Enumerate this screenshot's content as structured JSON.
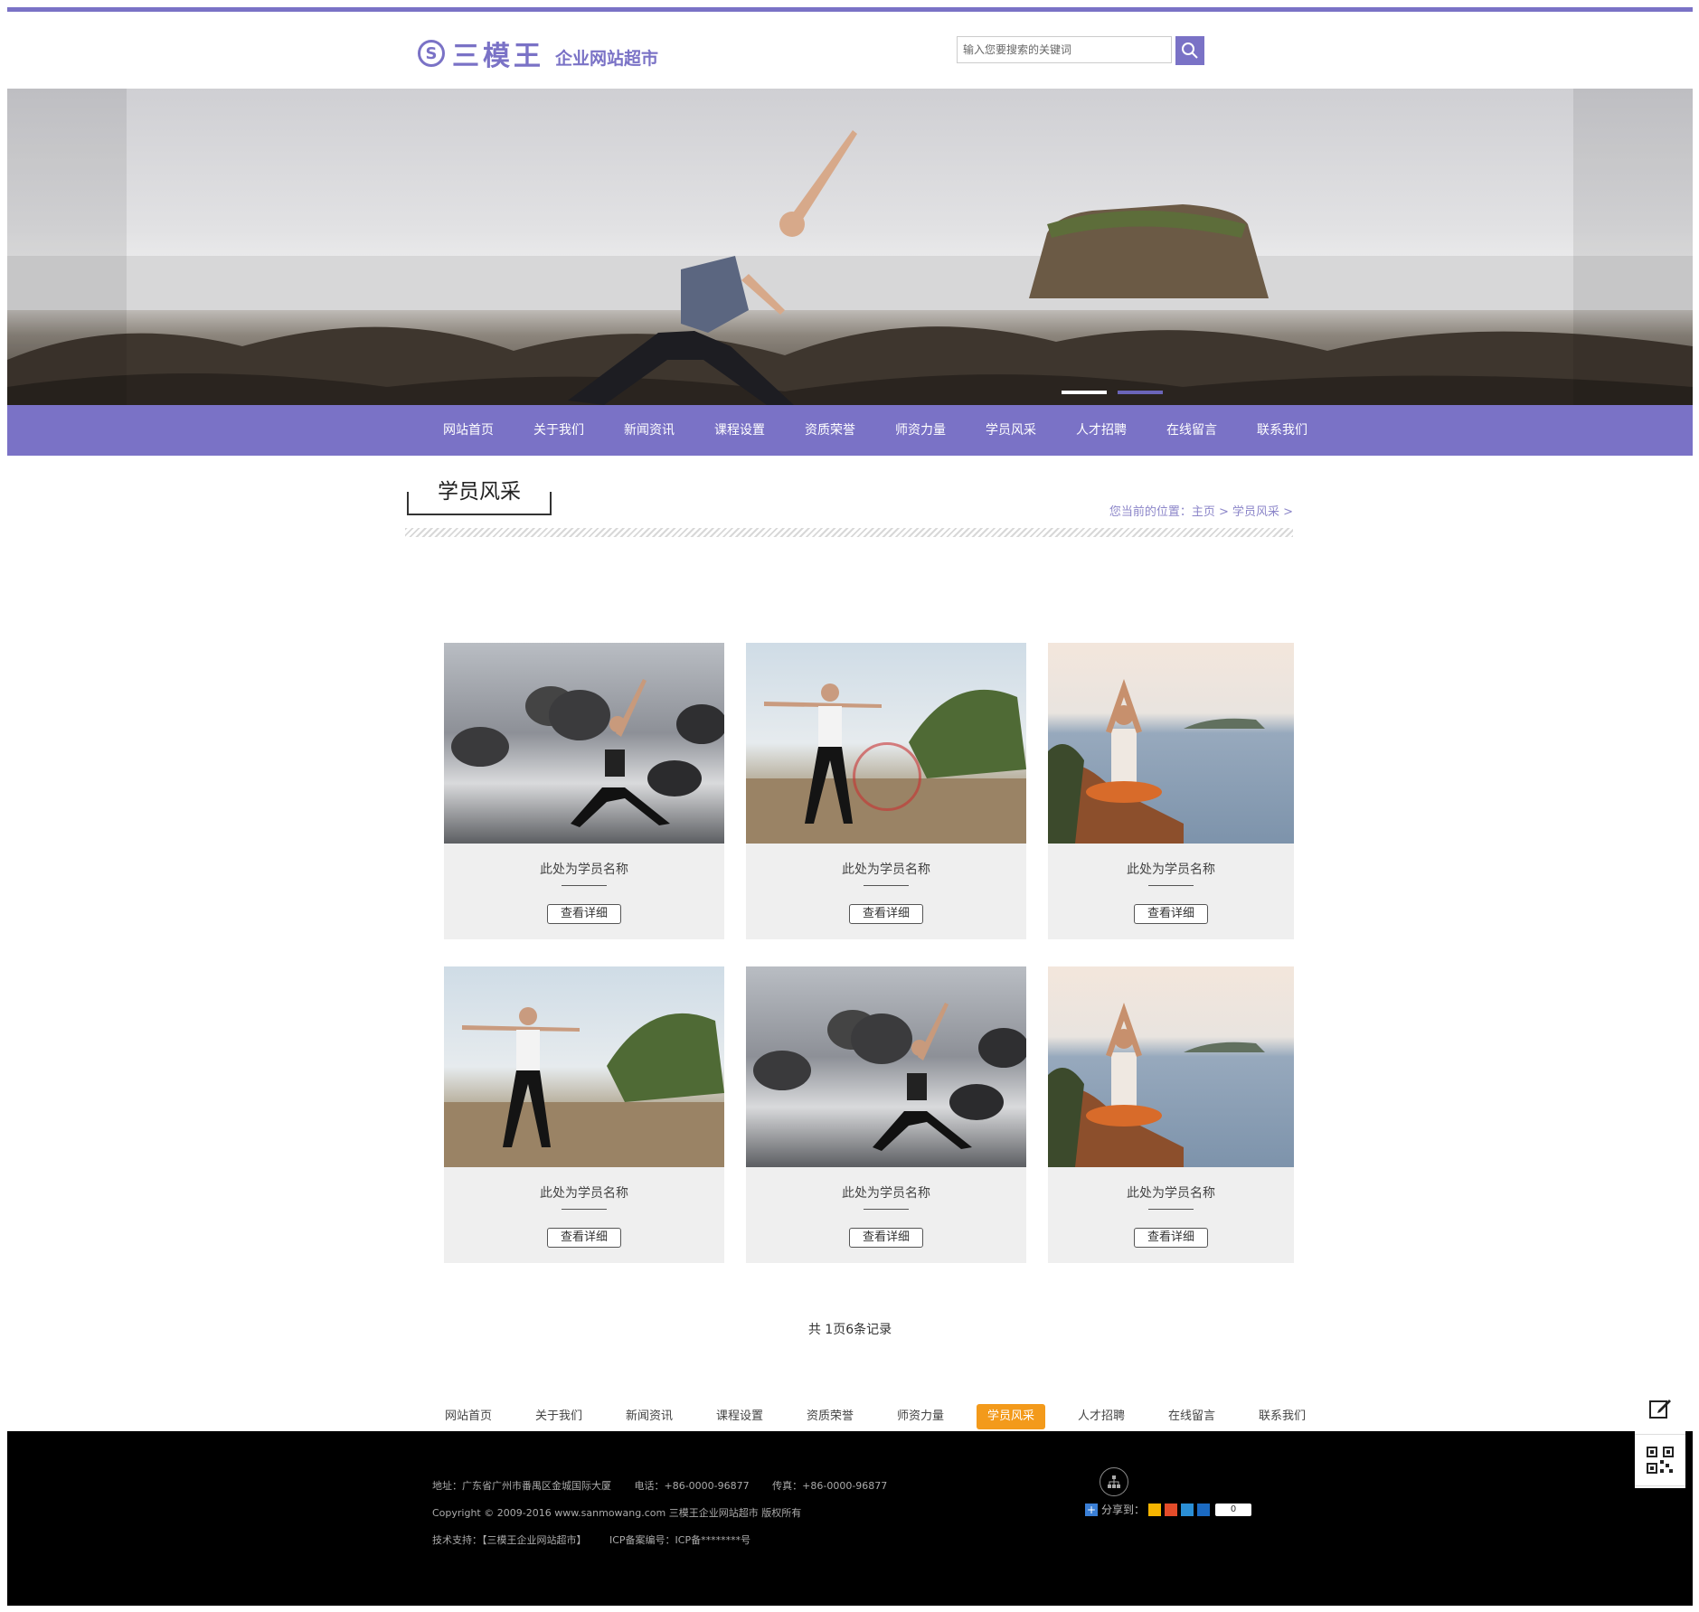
{
  "header": {
    "logo_mark": "S",
    "brand": "三模王",
    "brand_sub": "企业网站超市",
    "search_placeholder": "输入您要搜索的关键词"
  },
  "nav": [
    "网站首页",
    "关于我们",
    "新闻资讯",
    "课程设置",
    "资质荣誉",
    "师资力量",
    "学员风采",
    "人才招聘",
    "在线留言",
    "联系我们"
  ],
  "section": {
    "title": "学员风采",
    "breadcrumb": "您当前的位置：主页 > 学员风采 >"
  },
  "students": [
    {
      "name": "此处为学员名称",
      "button": "查看详细"
    },
    {
      "name": "此处为学员名称",
      "button": "查看详细"
    },
    {
      "name": "此处为学员名称",
      "button": "查看详细"
    },
    {
      "name": "此处为学员名称",
      "button": "查看详细"
    },
    {
      "name": "此处为学员名称",
      "button": "查看详细"
    },
    {
      "name": "此处为学员名称",
      "button": "查看详细"
    }
  ],
  "pager": "共 1页6条记录",
  "footer_nav": {
    "items": [
      "网站首页",
      "关于我们",
      "新闻资讯",
      "课程设置",
      "资质荣誉",
      "师资力量",
      "学员风采",
      "人才招聘",
      "在线留言",
      "联系我们"
    ],
    "active": "学员风采"
  },
  "footer": {
    "address": "地址：广东省广州市番禺区金城国际大厦",
    "phone": "电话：+86-0000-96877",
    "fax": "传真：+86-0000-96877",
    "copyright": "Copyright © 2009-2016 www.sanmowang.com 三模王企业网站超市 版权所有",
    "support": "技术支持：【三模王企业网站超市】",
    "icp": "ICP备案编号：ICP备********号",
    "share_label": "分享到：",
    "share_count": "0"
  },
  "colors": {
    "accent": "#7a72c6",
    "active": "#f39a1b",
    "footer_bg": "#000000"
  },
  "icons": [
    "search-icon",
    "sitemap-icon",
    "share-plus-icon",
    "edit-icon",
    "qrcode-icon"
  ]
}
